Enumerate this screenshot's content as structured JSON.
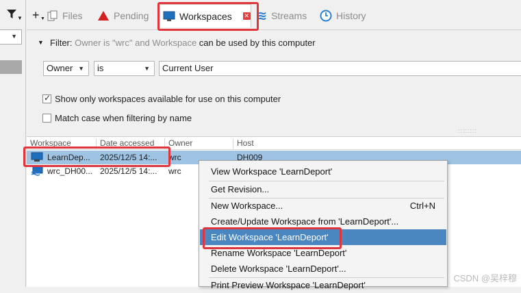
{
  "tabs": [
    {
      "label": "Files",
      "icon": "files-icon"
    },
    {
      "label": "Pending",
      "icon": "pending-icon",
      "icon_color": "#d02020"
    },
    {
      "label": "Workspaces",
      "icon": "workspace-icon",
      "active": true
    },
    {
      "label": "Streams",
      "icon": "streams-icon",
      "icon_color": "#2a7fd0"
    },
    {
      "label": "History",
      "icon": "history-icon",
      "icon_color": "#2a7fd0"
    }
  ],
  "filter": {
    "label": "Filter:",
    "summary_1": "Owner is \"wrc\" and Workspace",
    "summary_2": "can be used by this computer",
    "field": "Owner",
    "operator": "is",
    "value": "Current User",
    "check_available": "Show only workspaces available for use on this computer",
    "check_available_on": true,
    "check_case": "Match case when filtering by name",
    "check_case_on": false
  },
  "grid": {
    "columns": [
      "Workspace",
      "Date accessed",
      "Owner",
      "Host"
    ],
    "rows": [
      {
        "workspace": "LearnDep...",
        "date": "2025/12/5 14:...",
        "owner": "wrc",
        "host": "DH009"
      },
      {
        "workspace": "wrc_DH00...",
        "date": "2025/12/5 14:...",
        "owner": "wrc",
        "host": ""
      }
    ]
  },
  "context_menu": {
    "items": [
      {
        "label": "View Workspace 'LearnDeport'"
      },
      {
        "label": "Get Revision..."
      },
      {
        "label": "New Workspace...",
        "shortcut": "Ctrl+N"
      },
      {
        "label": "Create/Update Workspace from 'LearnDeport'..."
      },
      {
        "label": "Edit Workspace 'LearnDeport'",
        "highlighted": true
      },
      {
        "label": "Rename Workspace 'LearnDeport'"
      },
      {
        "label": "Delete Workspace 'LearnDeport'..."
      },
      {
        "label": "Print Preview Workspace 'LearnDeport'"
      }
    ]
  },
  "watermark": "CSDN @吴梓穆",
  "colors": {
    "accent": "#4a86c0",
    "selection": "#9fc3e2",
    "annotation": "#e0353d"
  }
}
